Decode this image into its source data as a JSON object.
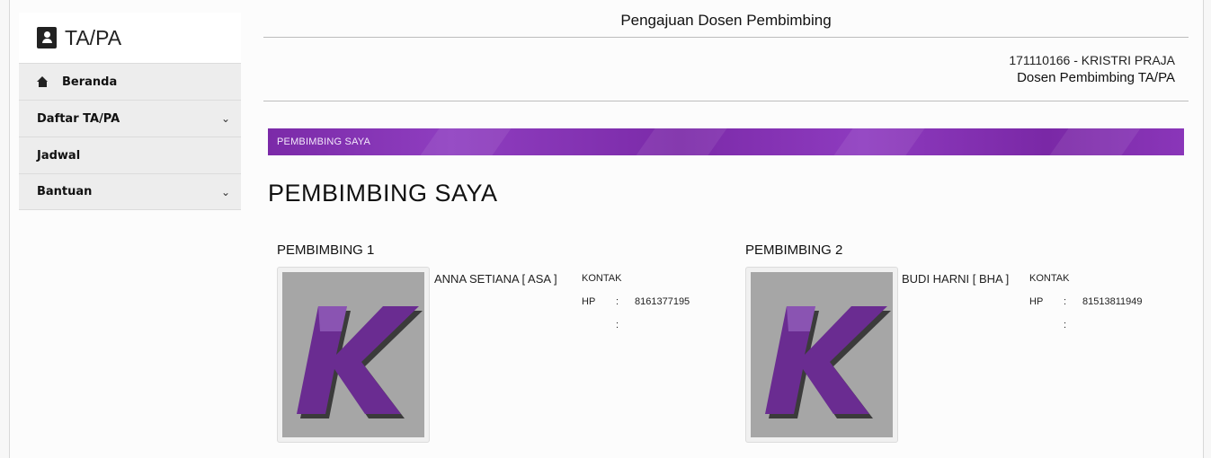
{
  "sidebar": {
    "brand": "TA/PA",
    "items": [
      {
        "label": "Beranda",
        "icon": "home-icon",
        "has_submenu": false
      },
      {
        "label": "Daftar TA/PA",
        "has_submenu": true
      },
      {
        "label": "Jadwal",
        "has_submenu": false
      },
      {
        "label": "Bantuan",
        "has_submenu": true
      }
    ],
    "chevron": "⌄"
  },
  "header": {
    "title": "Pengajuan Dosen Pembimbing",
    "user_id": "171110166 - KRISTRI PRAJA",
    "user_role": "Dosen Pembimbing TA/PA"
  },
  "banner": {
    "text": "PEMBIMBING SAYA"
  },
  "section": {
    "title": "PEMBIMBING SAYA"
  },
  "pembimbing": [
    {
      "heading": "PEMBIMBING 1",
      "name": "ANNA SETIANA [ ASA ]",
      "contact_label": "KONTAK",
      "hp_label": "HP",
      "colon": ":",
      "hp": "8161377195",
      "extra_value": ""
    },
    {
      "heading": "PEMBIMBING 2",
      "name": "BUDI HARNI [ BHA ]",
      "contact_label": "KONTAK",
      "hp_label": "HP",
      "colon": ":",
      "hp": "81513811949",
      "extra_value": ""
    }
  ],
  "colors": {
    "accent": "#7b2aa8",
    "logo_purple": "#6a2c91"
  }
}
